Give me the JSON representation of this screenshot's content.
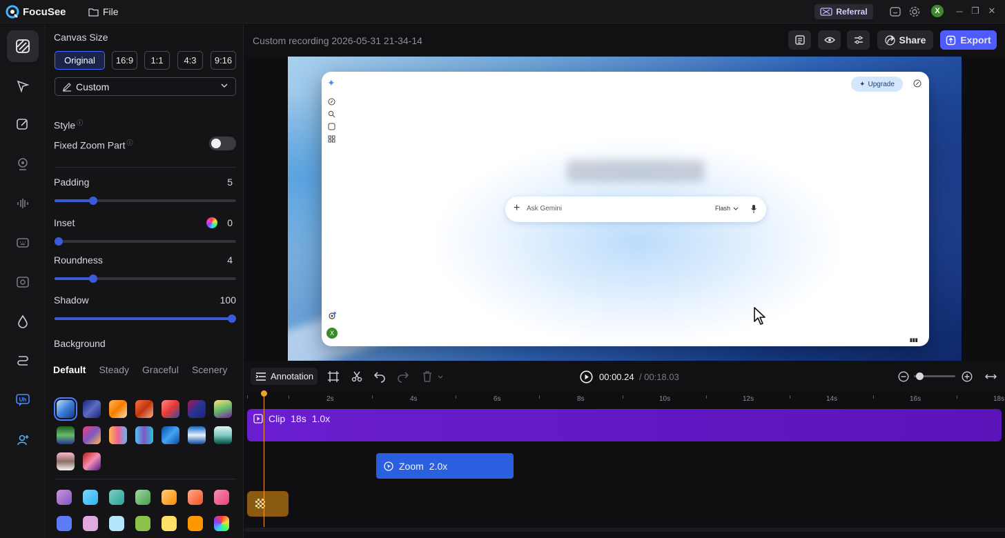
{
  "app": {
    "name": "FocuSee",
    "file_menu": "File",
    "referral": "Referral",
    "user_initial": "X"
  },
  "panel": {
    "canvas_size_label": "Canvas Size",
    "ratios": [
      "Original",
      "16:9",
      "1:1",
      "4:3",
      "9:16"
    ],
    "selected_ratio": "Original",
    "preset": "Custom",
    "style_label": "Style",
    "fixed_zoom_label": "Fixed Zoom Part",
    "fixed_zoom_on": false,
    "padding": {
      "label": "Padding",
      "value": "5"
    },
    "inset": {
      "label": "Inset",
      "value": "0"
    },
    "roundness": {
      "label": "Roundness",
      "value": "4"
    },
    "shadow": {
      "label": "Shadow",
      "value": "100"
    },
    "background_label": "Background",
    "background_tabs": [
      "Default",
      "Steady",
      "Graceful",
      "Scenery"
    ],
    "background_selected_tab": "Default"
  },
  "header": {
    "recording_title": "Custom recording 2026-05-31 21-34-14",
    "share": "Share",
    "export": "Export"
  },
  "preview": {
    "upgrade": "Upgrade",
    "ask_placeholder": "Ask Gemini",
    "model": "Flash",
    "user_initial": "X"
  },
  "timeline_toolbar": {
    "annotation": "Annotation",
    "current_time": "00:00.24",
    "total_time": "/ 00:18.03"
  },
  "timeline": {
    "ruler": [
      "2s",
      "4s",
      "6s",
      "8s",
      "10s",
      "12s",
      "14s",
      "16s",
      "18s"
    ],
    "clip": {
      "label": "Clip",
      "duration": "18s",
      "speed": "1.0x"
    },
    "zoom": {
      "label": "Zoom",
      "factor": "2.0x"
    }
  },
  "colors": {
    "accent": "#3f6bff",
    "export": "#4d5bff",
    "clip": "#6a1ed0",
    "zoom": "#2a5fe0",
    "playhead": "#f0a030"
  }
}
